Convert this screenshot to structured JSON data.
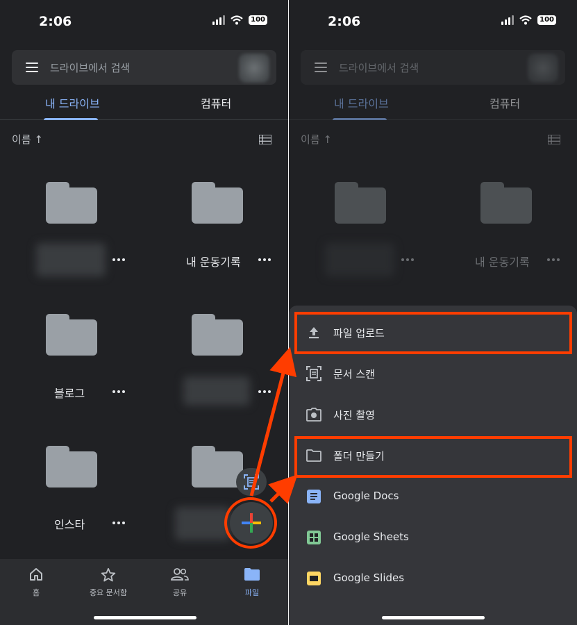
{
  "status": {
    "time": "2:06",
    "battery": "100"
  },
  "search": {
    "placeholder": "드라이브에서 검색"
  },
  "tabs": {
    "my_drive": "내 드라이브",
    "computers": "컴퓨터"
  },
  "sort": {
    "label": "이름 ↑"
  },
  "folders": [
    {
      "name": "",
      "blurred": true
    },
    {
      "name": "내 운동기록",
      "blurred": false
    },
    {
      "name": "블로그",
      "blurred": false
    },
    {
      "name": "",
      "blurred": true
    },
    {
      "name": "인스타",
      "blurred": false
    },
    {
      "name": "",
      "blurred": true
    }
  ],
  "bottom_nav": [
    {
      "label": "홈",
      "icon": "home-icon"
    },
    {
      "label": "중요 문서함",
      "icon": "star-icon"
    },
    {
      "label": "공유",
      "icon": "people-icon"
    },
    {
      "label": "파일",
      "icon": "folder-icon",
      "active": true
    }
  ],
  "sheet_menu": [
    {
      "label": "파일 업로드",
      "icon": "upload-icon",
      "highlighted": true
    },
    {
      "label": "문서 스캔",
      "icon": "scan-icon"
    },
    {
      "label": "사진 촬영",
      "icon": "camera-icon"
    },
    {
      "label": "폴더 만들기",
      "icon": "folder-outline-icon",
      "highlighted": true
    },
    {
      "label": "Google Docs",
      "icon": "docs-icon"
    },
    {
      "label": "Google Sheets",
      "icon": "sheets-icon"
    },
    {
      "label": "Google Slides",
      "icon": "slides-icon"
    }
  ],
  "colors": {
    "background": "#202124",
    "accent_blue": "#8ab4f8",
    "highlight_red": "#ff3d00",
    "docs": "#8ab4f8",
    "sheets": "#81c995",
    "slides": "#fdd663"
  }
}
